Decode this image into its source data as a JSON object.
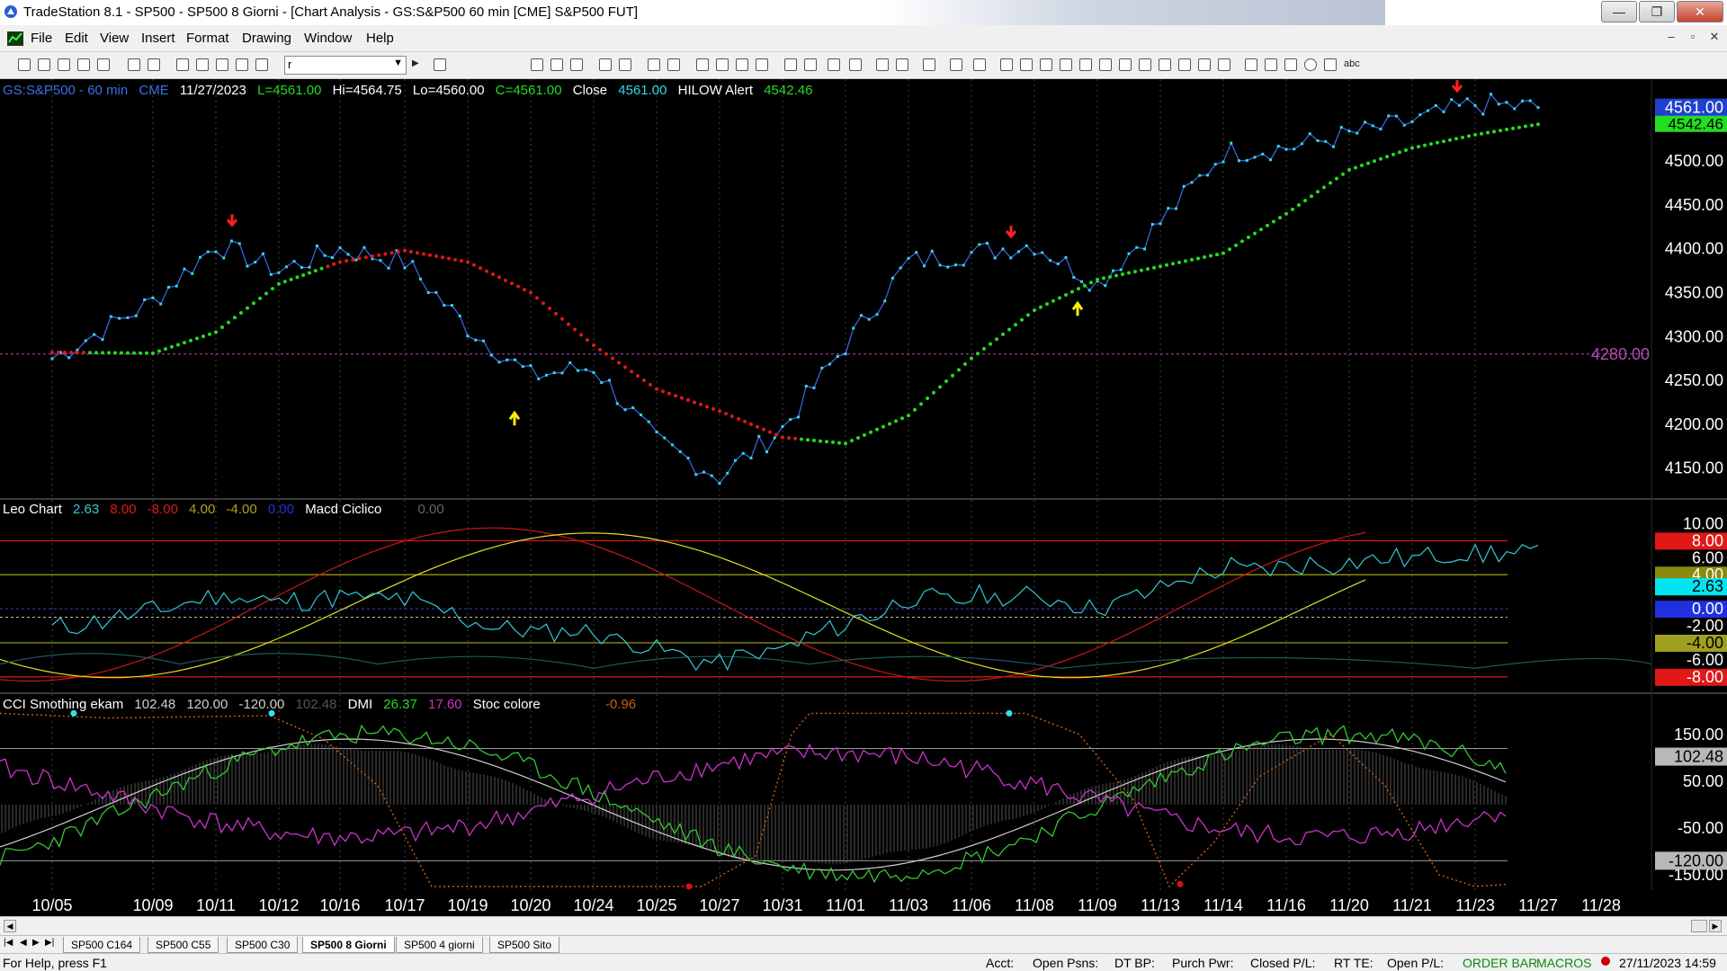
{
  "window": {
    "title": "TradeStation 8.1 - SP500 - SP500 8 Giorni - [Chart Analysis - GS:S&P500  60 min  [CME] S&P500 FUT]",
    "min_label": "—",
    "max_label": "❐",
    "close_label": "✕"
  },
  "menu": {
    "items": [
      "File",
      "Edit",
      "View",
      "Insert",
      "Format",
      "Drawing",
      "Window",
      "Help"
    ],
    "mdi_min": "–",
    "mdi_restore": "▫",
    "mdi_close": "✕"
  },
  "toolbar": {
    "symbol_value": "r",
    "symbol_dropdown": "▼",
    "arrow_glyph": "▶",
    "abc_label": "abc"
  },
  "price_pane": {
    "symbol": "GS:S&P500 - 60 min",
    "exchange": "CME",
    "date": "11/27/2023",
    "last": "L=4561.00",
    "high": "Hi=4564.75",
    "low": "Lo=4560.00",
    "close_eq": "C=4561.00",
    "close_label": "Close",
    "close_value": "4561.00",
    "hilow_label": "HILOW Alert",
    "hilow_value": "4542.46",
    "reference_level_label": "4280.00",
    "price_badge": "4561.00",
    "hilow_badge": "4542.46",
    "y_ticks": [
      "4500.00",
      "4450.00",
      "4400.00",
      "4350.00",
      "4300.00",
      "4250.00",
      "4200.00",
      "4150.00"
    ]
  },
  "leo_pane": {
    "name": "Leo Chart",
    "values": [
      "2.63",
      "8.00",
      "-8.00",
      "4.00",
      "-4.00",
      "0.00"
    ],
    "macd_label": "Macd Ciclico",
    "macd_value": "0.00",
    "y_ticks": [
      "10.00",
      "6.00",
      "-2.00",
      "-6.00"
    ],
    "badges": [
      "8.00",
      "4.00",
      "2.63",
      "0.00",
      "-4.00",
      "-8.00"
    ]
  },
  "cci_pane": {
    "name": "CCI Smothing ekam",
    "values": [
      "102.48",
      "120.00",
      "-120.00",
      "102.48"
    ],
    "dmi_label": "DMI",
    "dmi_values": [
      "26.37",
      "17.60"
    ],
    "stoc_label": "Stoc colore",
    "stoc_value": "-0.96",
    "y_ticks": [
      "150.00",
      "50.00",
      "-50.00",
      "-150.00"
    ],
    "badges": [
      "102.48",
      "-120.00"
    ]
  },
  "time_axis": [
    "10/05",
    "10/09",
    "10/11",
    "10/12",
    "10/16",
    "10/17",
    "10/19",
    "10/20",
    "10/24",
    "10/25",
    "10/27",
    "10/31",
    "11/01",
    "11/03",
    "11/06",
    "11/08",
    "11/09",
    "11/13",
    "11/14",
    "11/16",
    "11/20",
    "11/21",
    "11/23",
    "11/27",
    "11/28"
  ],
  "tabs": [
    "SP500 C164",
    "SP500 C55",
    "SP500 C30",
    "SP500 8 Giorni",
    "SP500 4 giorni",
    "SP500 Sito"
  ],
  "tab_nav": [
    "|◀",
    "◀",
    "▶",
    "▶|"
  ],
  "status": {
    "help": "For Help, press F1",
    "acct": "Acct:",
    "open_psns": "Open Psns:",
    "dt_bp": "DT BP:",
    "purch_pwr": "Purch Pwr:",
    "closed_pl": "Closed P/L:",
    "rt_te": "RT TE:",
    "open_pl": "Open P/L:",
    "order_bar": "ORDER BAR",
    "macros": "MACROS",
    "datetime": "27/11/2023 14:59"
  },
  "colors": {
    "price": "#33d6ee",
    "hilow_up": "#22dd22",
    "hilow_down": "#e01818",
    "reference": "#b04db0",
    "osc_cyan": "#33c8d4",
    "osc_red": "#c81818",
    "osc_yellow": "#e0e020",
    "cci_white": "#cfcfcf",
    "cci_green": "#33c833",
    "cci_magenta": "#cc33cc",
    "cci_orange": "#d06010",
    "cci_red": "#d41010",
    "axis_text": "#ffffff"
  },
  "chart_data": {
    "type": "line",
    "series": [
      {
        "name": "Close",
        "x": [
          "10/05",
          "10/09",
          "10/11",
          "10/12",
          "10/16",
          "10/17",
          "10/19",
          "10/20",
          "10/24",
          "10/25",
          "10/27",
          "10/31",
          "11/01",
          "11/03",
          "11/06",
          "11/08",
          "11/09",
          "11/13",
          "11/14",
          "11/16",
          "11/20",
          "11/21",
          "11/23",
          "11/27"
        ],
        "values": [
          4275,
          4340,
          4405,
          4375,
          4400,
          4385,
          4310,
          4255,
          4265,
          4180,
          4140,
          4195,
          4290,
          4385,
          4395,
          4405,
          4360,
          4430,
          4510,
          4515,
          4530,
          4545,
          4565,
          4561
        ]
      },
      {
        "name": "HILOW Alert",
        "x": [
          "10/05",
          "10/09",
          "10/11",
          "10/12",
          "10/16",
          "10/17",
          "10/19",
          "10/20",
          "10/24",
          "10/25",
          "10/27",
          "10/31",
          "11/01",
          "11/03",
          "11/06",
          "11/08",
          "11/09",
          "11/13",
          "11/14",
          "11/16",
          "11/20",
          "11/21",
          "11/23",
          "11/27"
        ],
        "values": [
          4282,
          4281,
          4305,
          4360,
          4385,
          4398,
          4385,
          4350,
          4290,
          4240,
          4215,
          4185,
          4178,
          4210,
          4275,
          4330,
          4365,
          4380,
          4395,
          4440,
          4490,
          4515,
          4530,
          4542
        ]
      }
    ],
    "ylabel": "",
    "ylim": [
      4125,
      4575
    ],
    "reference_line": 4280
  }
}
